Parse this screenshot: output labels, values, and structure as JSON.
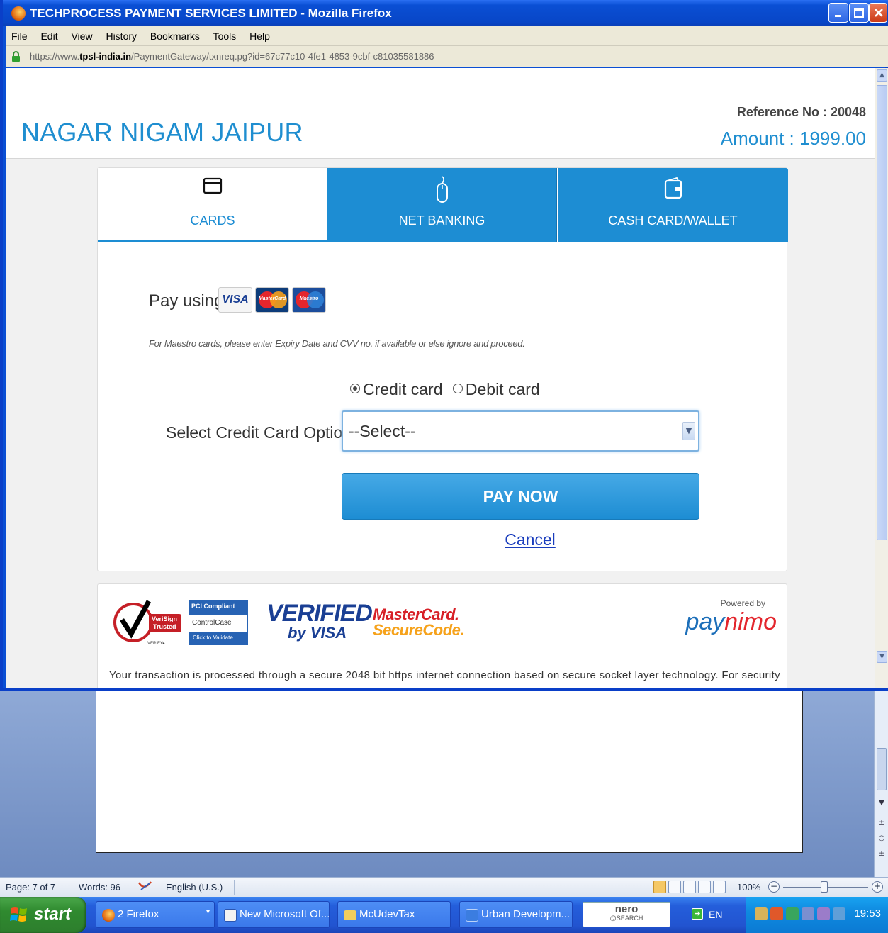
{
  "window": {
    "title": "TECHPROCESS PAYMENT SERVICES LIMITED - Mozilla Firefox",
    "menu": [
      "File",
      "Edit",
      "View",
      "History",
      "Bookmarks",
      "Tools",
      "Help"
    ],
    "url_prefix": "https://www.",
    "url_domain": "tpsl-india.in",
    "url_path": "/PaymentGateway/txnreq.pg?id=67c77c10-4fe1-4853-9cbf-c81035581886"
  },
  "header": {
    "org_name": "NAGAR NIGAM JAIPUR",
    "reference": "Reference No : 20048",
    "amount": "Amount : 1999.00"
  },
  "tabs": [
    {
      "label": "CARDS",
      "icon": "card-icon",
      "active": true
    },
    {
      "label": "NET BANKING",
      "icon": "mouse-icon",
      "active": false
    },
    {
      "label": "CASH CARD/WALLET",
      "icon": "wallet-icon",
      "active": false
    }
  ],
  "cards": {
    "pay_using": "Pay using",
    "logos": {
      "visa": "VISA",
      "mastercard": "MasterCard",
      "maestro": "Maestro"
    },
    "maestro_note": "For Maestro cards, please enter Expiry Date and CVV no. if available or else ignore and proceed.",
    "radio_credit": "Credit card",
    "radio_debit": "Debit card",
    "select_label": "Select Credit Card Option :",
    "select_value": "--Select--",
    "pay_button": "PAY NOW",
    "cancel": "Cancel"
  },
  "trust": {
    "verisign_1": "VeriSign",
    "verisign_2": "Trusted",
    "verisign_3": "VERIFY▸",
    "pci_1": "PCI Compliant",
    "pci_2": "ControlCase",
    "pci_3": "Click to Validate",
    "vbv_1": "VERIFIED",
    "vbv_2": "by VISA",
    "mc_1": "MasterCard.",
    "mc_2": "SecureCode.",
    "powered": "Powered by",
    "paynimo_1": "pay",
    "paynimo_2": "nimo",
    "secure_text": "Your transaction is processed through a secure 2048 bit https internet connection based on secure socket layer technology. For security"
  },
  "word_status": {
    "page": "Page: 7 of 7",
    "words": "Words: 96",
    "language": "English (U.S.)",
    "zoom": "100%"
  },
  "taskbar": {
    "start": "start",
    "items": [
      "2 Firefox",
      "New Microsoft Of...",
      "McUdevTax",
      "Urban Developm..."
    ],
    "nero": "nero",
    "nero_sub": "@SEARCH",
    "lang": "EN",
    "clock": "19:53"
  },
  "colors": {
    "brand": "#1d8dd3",
    "link": "#1a3dbd",
    "xp_blue": "#0a4fd4",
    "start_green": "#2f8a2f"
  }
}
